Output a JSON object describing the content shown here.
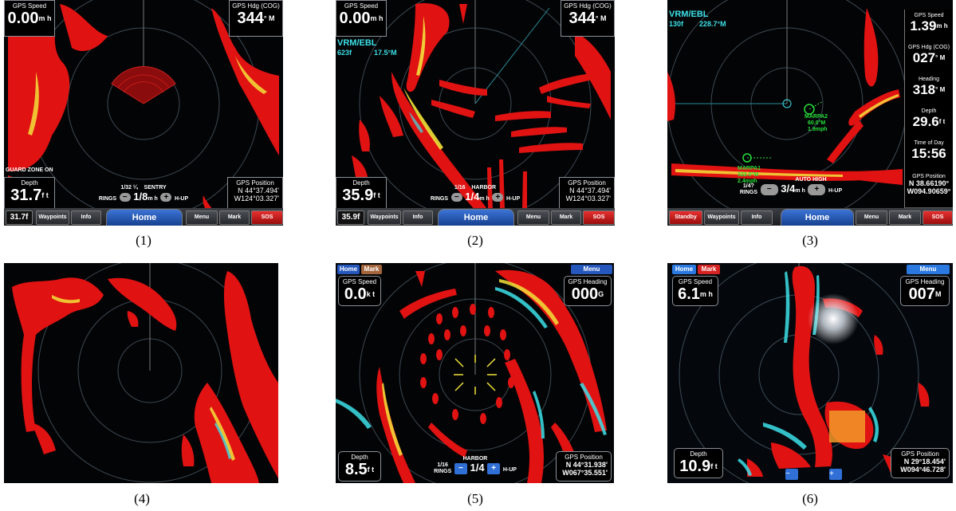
{
  "colors": {
    "echo_red": "#e01212",
    "echo_yellow": "#f2e23a",
    "echo_cyan": "#3ce0e8",
    "home_blue": "#2557bd",
    "sos_red": "#d21c1c"
  },
  "captions": [
    "(1)",
    "(2)",
    "(3)",
    "(4)",
    "(5)",
    "(6)"
  ],
  "panel1": {
    "speed_label": "GPS Speed",
    "speed_value": "0.00",
    "speed_unit": "m h",
    "hdg_label": "GPS Hdg (COG)",
    "hdg_value": "344",
    "hdg_unit": "° M",
    "guard": "GUARD ZONE ON",
    "depth_label": "Depth",
    "depth_value": "31.7",
    "depth_unit": "f t",
    "rings": "1/32 ¼",
    "rings_label": "RINGS",
    "mode": "SENTRY",
    "range": "1/8",
    "range_unit": "m h",
    "orient": "H-UP",
    "pos_label": "GPS Position",
    "pos_lat": "N  44°37.494'",
    "pos_lon": "W124°03.327'",
    "buttons": {
      "depth": "31.7f",
      "waypoints": "Waypoints",
      "info": "Info",
      "home": "Home",
      "menu": "Menu",
      "mark": "Mark",
      "sos": "SOS"
    }
  },
  "panel2": {
    "speed_label": "GPS Speed",
    "speed_value": "0.00",
    "speed_unit": "m h",
    "hdg_label": "GPS Hdg (COG)",
    "hdg_value": "344",
    "hdg_unit": "° M",
    "vrm_title": "VRM/EBL",
    "vrm_range": "623f",
    "vrm_bearing": "17.5°M",
    "depth_label": "Depth",
    "depth_value": "35.9",
    "depth_unit": "f t",
    "rings": "1/16",
    "rings_label": "RINGS",
    "mode": "HARBOR",
    "range": "1/4",
    "range_unit": "m h",
    "orient": "H-UP",
    "pos_label": "GPS Position",
    "pos_lat": "N  44°37.494'",
    "pos_lon": "W124°03.327'",
    "buttons": {
      "depth": "35.9f",
      "waypoints": "Waypoints",
      "info": "Info",
      "home": "Home",
      "menu": "Menu",
      "mark": "Mark",
      "sos": "SOS"
    }
  },
  "panel3": {
    "vrm_title": "VRM/EBL",
    "vrm_range": "130f",
    "vrm_bearing": "228.7°M",
    "side": [
      {
        "label": "GPS Speed",
        "value": "1.39",
        "unit": "m h"
      },
      {
        "label": "GPS Hdg (COG)",
        "value": "027",
        "unit": "° M"
      },
      {
        "label": "Heading",
        "value": "318",
        "unit": "° M"
      },
      {
        "label": "Depth",
        "value": "29.6",
        "unit": "f t"
      },
      {
        "label": "Time of Day",
        "value": "15:56",
        "unit": ""
      }
    ],
    "pos_label": "GPS Position",
    "pos_lat": "N  38.66190°",
    "pos_lon": "W094.90659°",
    "marpa2_name": "MARPA2",
    "marpa2_range": "60.0°M",
    "marpa2_speed": "1.9mph",
    "marpa1_name": "MARPA1",
    "marpa1_range": "322.0°M",
    "marpa1_speed": "2.4mph",
    "rings": "1/4?",
    "rings_label": "RINGS",
    "mode": "AUTO HIGH",
    "range": "3/4",
    "range_unit": "m h",
    "orient": "H-UP",
    "buttons": {
      "standby": "Standby",
      "waypoints": "Waypoints",
      "info": "Info",
      "home": "Home",
      "menu": "Menu",
      "mark": "Mark",
      "sos": "SOS"
    }
  },
  "panel5": {
    "home": "Home",
    "mark": "Mark",
    "menu": "Menu",
    "speed_label": "GPS Speed",
    "speed_value": "0.0",
    "speed_unit": "k t",
    "hdg_label": "GPS Heading",
    "hdg_value": "000",
    "hdg_unit": "G",
    "depth_label": "Depth",
    "depth_value": "8.5",
    "depth_unit": "f t",
    "rings": "1/16",
    "rings_label": "RINGS",
    "mode": "HARBOR",
    "range": "1/4",
    "orient": "H-UP",
    "pos_label": "GPS Position",
    "pos_lat": "N  44°31.938'",
    "pos_lon": "W067°35.551'"
  },
  "panel6": {
    "home": "Home",
    "mark": "Mark",
    "menu": "Menu",
    "speed_label": "GPS Speed",
    "speed_value": "6.1",
    "speed_unit": "m h",
    "hdg_label": "GPS Heading",
    "hdg_value": "007",
    "hdg_unit": "M",
    "depth_label": "Depth",
    "depth_value": "10.9",
    "depth_unit": "f t",
    "pos_label": "GPS Position",
    "pos_lat": "N  29°18.454'",
    "pos_lon": "W094°46.728'"
  }
}
